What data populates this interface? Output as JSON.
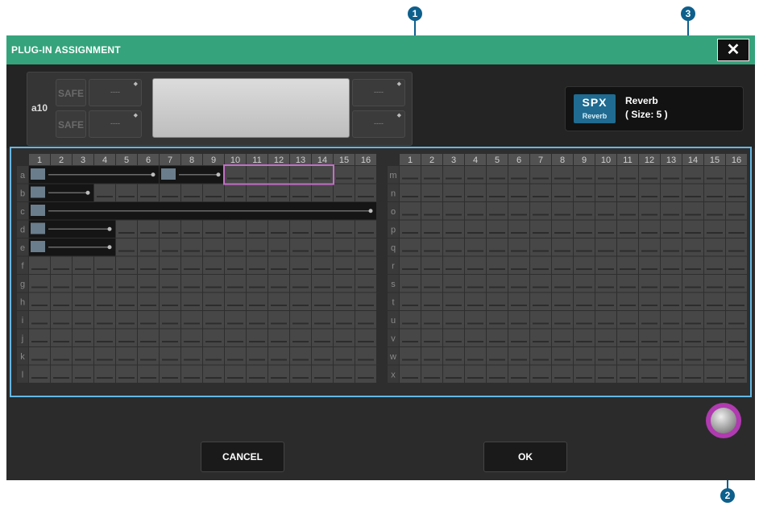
{
  "window": {
    "title": "PLUG-IN ASSIGNMENT",
    "close_icon": "close-icon",
    "accent_color": "#35a37c"
  },
  "rack": {
    "slot_label": "a10",
    "safe_labels": [
      "SAFE",
      "SAFE"
    ],
    "left_boxes": [
      "----",
      "----"
    ],
    "right_boxes": [
      "----",
      "----"
    ]
  },
  "plugin_info": {
    "logo": "SPX",
    "logo_sub": "Reverb",
    "name": "Reverb",
    "size": "( Size: 5 )"
  },
  "grid": {
    "column_numbers": [
      "1",
      "2",
      "3",
      "4",
      "5",
      "6",
      "7",
      "8",
      "9",
      "10",
      "11",
      "12",
      "13",
      "14",
      "15",
      "16"
    ],
    "left_rows": [
      "a",
      "b",
      "c",
      "d",
      "e",
      "f",
      "g",
      "h",
      "i",
      "j",
      "k",
      "l"
    ],
    "right_rows": [
      "m",
      "n",
      "o",
      "p",
      "q",
      "r",
      "s",
      "t",
      "u",
      "v",
      "w",
      "x"
    ],
    "assignments": [
      {
        "row": 0,
        "start": 0,
        "length": 6
      },
      {
        "row": 0,
        "start": 6,
        "length": 3
      },
      {
        "row": 1,
        "start": 0,
        "length": 3
      },
      {
        "row": 2,
        "start": 0,
        "length": 16
      },
      {
        "row": 3,
        "start": 0,
        "length": 4
      },
      {
        "row": 4,
        "start": 0,
        "length": 4
      }
    ],
    "selection": {
      "row": 0,
      "start": 9,
      "length": 5
    },
    "selection_color": "#c46ec9"
  },
  "buttons": {
    "cancel": "CANCEL",
    "ok": "OK"
  },
  "knob": {
    "icon": "knob-icon",
    "ring_color": "#b03ab0"
  },
  "callouts": [
    "1",
    "2",
    "3"
  ]
}
